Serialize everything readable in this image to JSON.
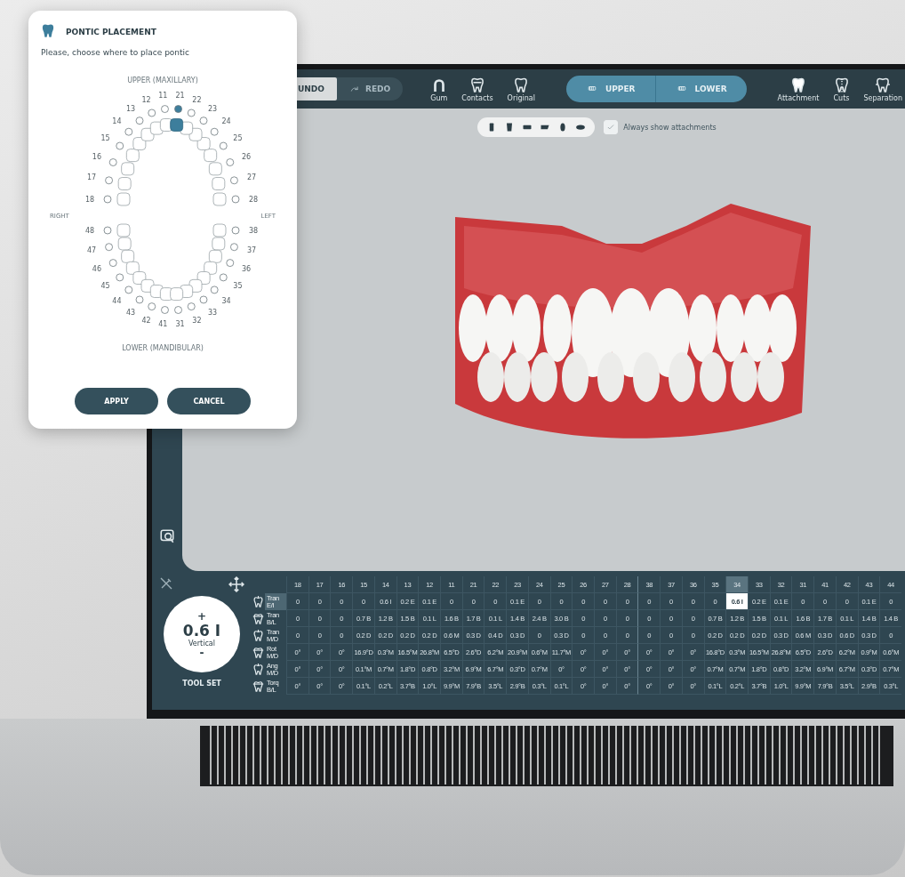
{
  "pontic_dialog": {
    "title": "PONTIC PLACEMENT",
    "prompt": "Please, choose where to place pontic",
    "upper_label": "UPPER (MAXILLARY)",
    "lower_label": "LOWER (MANDIBULAR)",
    "right_label": "RIGHT",
    "left_label": "LEFT",
    "upper_right": [
      {
        "number": "18",
        "selected": false
      },
      {
        "number": "17",
        "selected": false
      },
      {
        "number": "16",
        "selected": false
      },
      {
        "number": "15",
        "selected": false
      },
      {
        "number": "14",
        "selected": false
      },
      {
        "number": "13",
        "selected": false
      },
      {
        "number": "12",
        "selected": false
      },
      {
        "number": "11",
        "selected": false
      }
    ],
    "upper_left": [
      {
        "number": "28",
        "selected": false
      },
      {
        "number": "27",
        "selected": false
      },
      {
        "number": "26",
        "selected": false
      },
      {
        "number": "25",
        "selected": false
      },
      {
        "number": "24",
        "selected": false
      },
      {
        "number": "23",
        "selected": false
      },
      {
        "number": "22",
        "selected": false
      },
      {
        "number": "21",
        "selected": true
      }
    ],
    "lower_right": [
      {
        "number": "48",
        "selected": false
      },
      {
        "number": "47",
        "selected": false
      },
      {
        "number": "46",
        "selected": false
      },
      {
        "number": "45",
        "selected": false
      },
      {
        "number": "44",
        "selected": false
      },
      {
        "number": "43",
        "selected": false
      },
      {
        "number": "42",
        "selected": false
      },
      {
        "number": "41",
        "selected": false
      }
    ],
    "lower_left": [
      {
        "number": "38",
        "selected": false
      },
      {
        "number": "37",
        "selected": false
      },
      {
        "number": "36",
        "selected": false
      },
      {
        "number": "35",
        "selected": false
      },
      {
        "number": "34",
        "selected": false
      },
      {
        "number": "33",
        "selected": false
      },
      {
        "number": "32",
        "selected": false
      },
      {
        "number": "31",
        "selected": false
      }
    ],
    "buttons": [
      "APPLY",
      "CANCEL"
    ]
  },
  "toolbar": {
    "undo": {
      "label": "UNDO",
      "disabled": false
    },
    "redo": {
      "label": "REDO",
      "disabled": true
    },
    "view_tools": [
      "Gum",
      "Contacts",
      "Original"
    ],
    "jaws": [
      {
        "label": "UPPER",
        "selected": true
      },
      {
        "label": "LOWER",
        "selected": true
      }
    ],
    "stage_tools": [
      "Attachment",
      "Cuts",
      "Separation"
    ]
  },
  "viewport": {
    "always_show_attachments": {
      "label": "Always show attachments",
      "checked": true
    }
  },
  "tool_set": {
    "value": "0.6 I",
    "axis": "Vertical",
    "plus": "+",
    "minus": "-",
    "label": "TOOL SET"
  },
  "movement_table": {
    "column_groups": [
      {
        "columns": [
          {
            "label": "18",
            "selected": false
          },
          {
            "label": "17",
            "selected": false
          },
          {
            "label": "16",
            "selected": false
          },
          {
            "label": "15",
            "selected": false
          },
          {
            "label": "14",
            "selected": false
          },
          {
            "label": "13",
            "selected": false
          },
          {
            "label": "12",
            "selected": false
          },
          {
            "label": "11",
            "selected": false
          },
          {
            "label": "21",
            "selected": false
          },
          {
            "label": "22",
            "selected": false
          },
          {
            "label": "23",
            "selected": false
          },
          {
            "label": "24",
            "selected": false
          },
          {
            "label": "25",
            "selected": false
          },
          {
            "label": "26",
            "selected": false
          },
          {
            "label": "27",
            "selected": false
          },
          {
            "label": "28",
            "selected": false
          }
        ]
      },
      {
        "columns": [
          {
            "label": "38",
            "selected": false
          },
          {
            "label": "37",
            "selected": false
          },
          {
            "label": "36",
            "selected": false
          },
          {
            "label": "35",
            "selected": false
          },
          {
            "label": "34",
            "selected": true
          },
          {
            "label": "33",
            "selected": false
          },
          {
            "label": "32",
            "selected": false
          },
          {
            "label": "31",
            "selected": false
          },
          {
            "label": "41",
            "selected": false
          },
          {
            "label": "42",
            "selected": false
          },
          {
            "label": "43",
            "selected": false
          },
          {
            "label": "44",
            "selected": false
          }
        ]
      }
    ],
    "rows": [
      {
        "name": "Tran",
        "axis": "E/I",
        "selected": true,
        "cells": [
          [
            "0",
            "0",
            "0",
            "0",
            "0.6 I",
            "0.2 E",
            "0.1 E",
            "0",
            "0",
            "0",
            "0.1 E",
            "0",
            "0",
            "0",
            "0",
            "0"
          ],
          [
            "0",
            "0",
            "0",
            "0",
            "0.6 I",
            "0.2 E",
            "0.1 E",
            "0",
            "0",
            "0",
            "0.1 E",
            "0"
          ]
        ]
      },
      {
        "name": "Tran",
        "axis": "B/L",
        "selected": false,
        "cells": [
          [
            "0",
            "0",
            "0",
            "0.7 B",
            "1.2 B",
            "1.5 B",
            "0.1 L",
            "1.6 B",
            "1.7 B",
            "0.1 L",
            "1.4 B",
            "2.4 B",
            "3.0 B",
            "0",
            "0",
            "0"
          ],
          [
            "0",
            "0",
            "0",
            "0.7 B",
            "1.2 B",
            "1.5 B",
            "0.1 L",
            "1.6 B",
            "1.7 B",
            "0.1 L",
            "1.4 B",
            "1.4 B"
          ]
        ]
      },
      {
        "name": "Tran",
        "axis": "M/D",
        "selected": false,
        "cells": [
          [
            "0",
            "0",
            "0",
            "0.2 D",
            "0.2 D",
            "0.2 D",
            "0.2 D",
            "0.6 M",
            "0.3 D",
            "0.4 D",
            "0.3 D",
            "0",
            "0.3 D",
            "0",
            "0",
            "0"
          ],
          [
            "0",
            "0",
            "0",
            "0.2 D",
            "0.2 D",
            "0.2 D",
            "0.3 D",
            "0.6 M",
            "0.3 D",
            "0.6 D",
            "0.3 D",
            "0"
          ]
        ]
      },
      {
        "name": "Rot",
        "axis": "M/D",
        "selected": false,
        "cells": [
          [
            "0°",
            "0°",
            "0°",
            "16.9°D",
            "0.3°M",
            "16.5°M",
            "26.8°M",
            "6.5°D",
            "2.6°D",
            "6.2°M",
            "20.9°M",
            "0.6°M",
            "11.7°M",
            "0°",
            "0°",
            "0°"
          ],
          [
            "0°",
            "0°",
            "0°",
            "16.8°D",
            "0.3°M",
            "16.5°M",
            "26.8°M",
            "6.5°D",
            "2.6°D",
            "6.2°M",
            "0.9°M",
            "0.6°M"
          ]
        ]
      },
      {
        "name": "Ang",
        "axis": "M/D",
        "selected": false,
        "cells": [
          [
            "0°",
            "0°",
            "0°",
            "0.1°M",
            "0.7°M",
            "1.8°D",
            "0.8°D",
            "3.2°M",
            "6.9°M",
            "6.7°M",
            "0.3°D",
            "0.7°M",
            "0°",
            "0°",
            "0°",
            "0°"
          ],
          [
            "0°",
            "0°",
            "0°",
            "0.7°M",
            "0.7°M",
            "1.8°D",
            "0.8°D",
            "3.2°M",
            "6.9°M",
            "6.7°M",
            "0.3°D",
            "0.7°M"
          ]
        ]
      },
      {
        "name": "Torq",
        "axis": "B/L",
        "selected": false,
        "cells": [
          [
            "0°",
            "0°",
            "0°",
            "0.1°L",
            "0.2°L",
            "3.7°B",
            "1.0°L",
            "9.9°M",
            "7.9°B",
            "3.5°L",
            "2.9°B",
            "0.3°L",
            "0.1°L",
            "0°",
            "0°",
            "0°"
          ],
          [
            "0°",
            "0°",
            "0°",
            "0.1°L",
            "0.2°L",
            "3.7°B",
            "1.0°L",
            "9.9°M",
            "7.9°B",
            "3.5°L",
            "2.9°B",
            "0.3°L"
          ]
        ]
      }
    ]
  }
}
